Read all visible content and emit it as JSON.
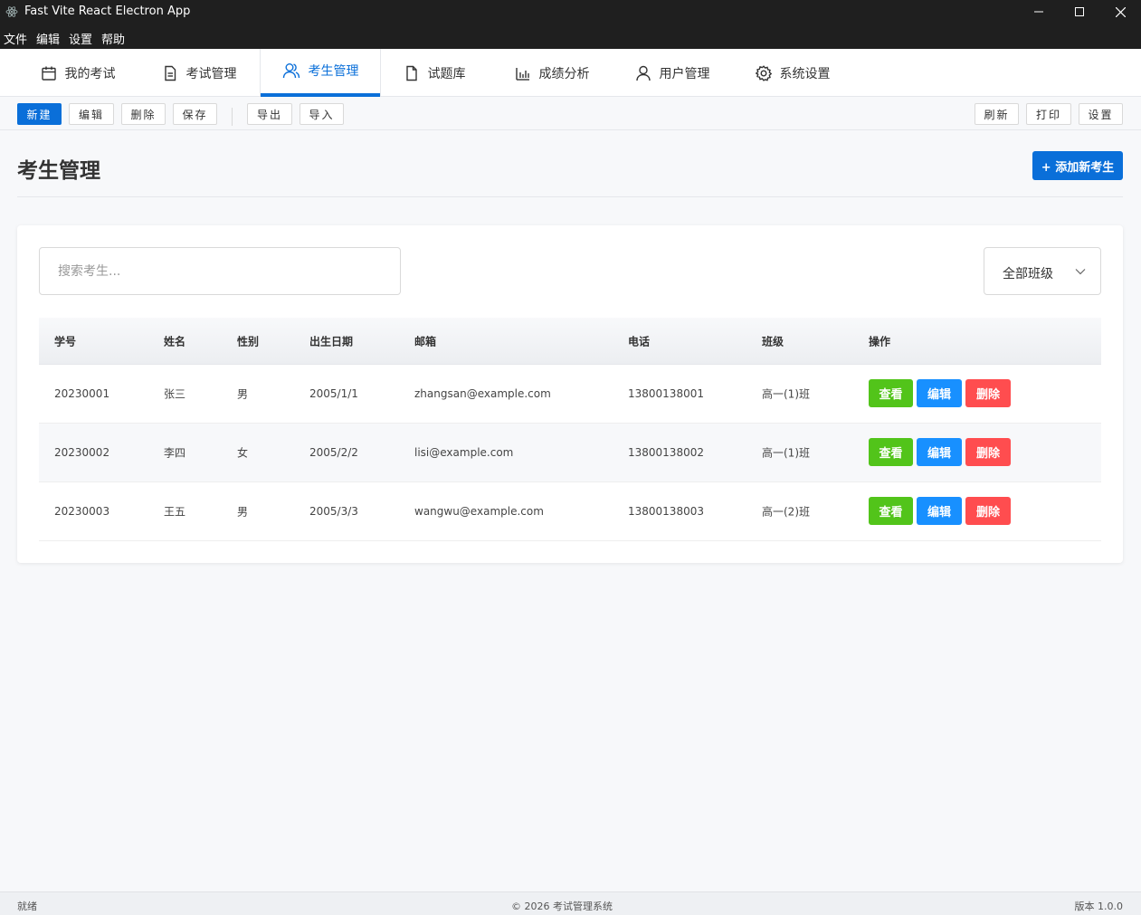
{
  "window": {
    "title": "Fast Vite React Electron App"
  },
  "menu": [
    "文件",
    "编辑",
    "设置",
    "帮助"
  ],
  "tabs": [
    {
      "label": "我的考试",
      "icon": "calendar-icon"
    },
    {
      "label": "考试管理",
      "icon": "document-icon"
    },
    {
      "label": "考生管理",
      "icon": "users-icon",
      "active": true
    },
    {
      "label": "试题库",
      "icon": "file-icon"
    },
    {
      "label": "成绩分析",
      "icon": "bar-chart-icon"
    },
    {
      "label": "用户管理",
      "icon": "user-icon"
    },
    {
      "label": "系统设置",
      "icon": "gear-icon"
    }
  ],
  "toolbar": {
    "new": "新建",
    "edit": "编辑",
    "delete": "删除",
    "save": "保存",
    "export": "导出",
    "import": "导入",
    "refresh": "刷新",
    "print": "打印",
    "settings": "设置"
  },
  "page": {
    "title": "考生管理",
    "add_button": "+ 添加新考生"
  },
  "filters": {
    "search_placeholder": "搜索考生...",
    "class_select": "全部班级"
  },
  "table": {
    "headers": [
      "学号",
      "姓名",
      "性别",
      "出生日期",
      "邮箱",
      "电话",
      "班级",
      "操作"
    ],
    "rows": [
      [
        "20230001",
        "张三",
        "男",
        "2005/1/1",
        "zhangsan@example.com",
        "13800138001",
        "高一(1)班"
      ],
      [
        "20230002",
        "李四",
        "女",
        "2005/2/2",
        "lisi@example.com",
        "13800138002",
        "高一(1)班"
      ],
      [
        "20230003",
        "王五",
        "男",
        "2005/3/3",
        "wangwu@example.com",
        "13800138003",
        "高一(2)班"
      ]
    ],
    "actions": {
      "view": "查看",
      "edit": "编辑",
      "delete": "删除"
    }
  },
  "status": {
    "left": "就绪",
    "center": "© 2026 考试管理系统",
    "right": "版本 1.0.0"
  },
  "colors": {
    "primary": "#0a6fd9",
    "view": "#52c41a",
    "edit": "#1890ff",
    "delete": "#ff4d4f"
  }
}
